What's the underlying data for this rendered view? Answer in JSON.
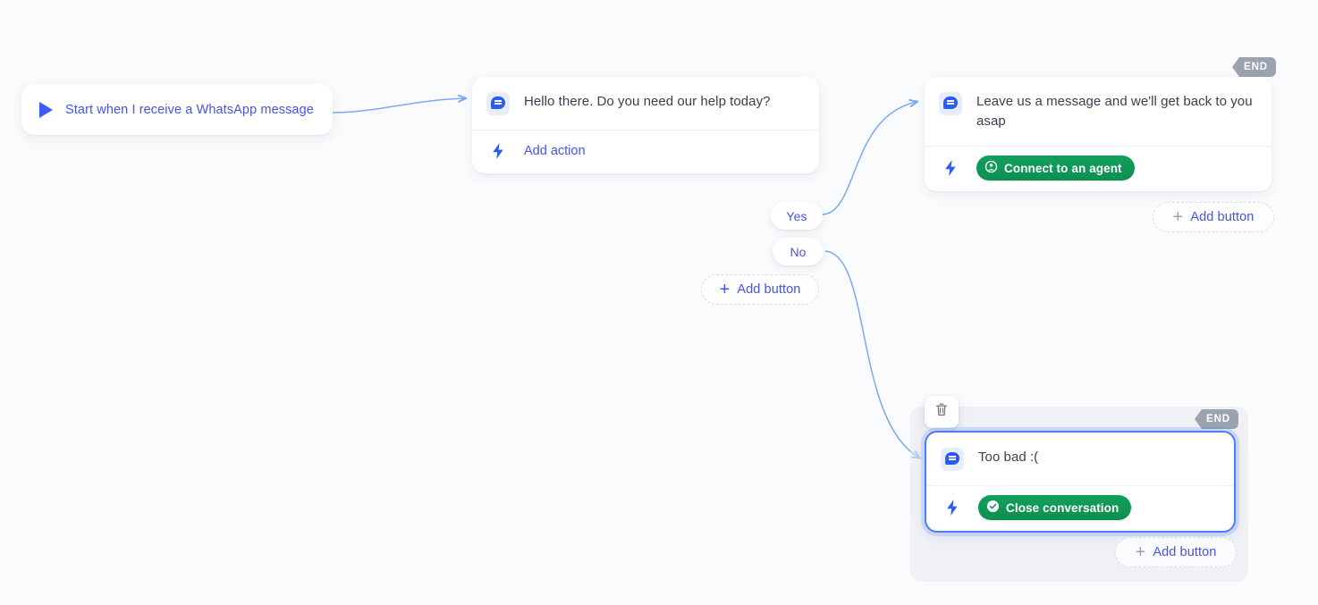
{
  "canvas": {
    "background_color": "#fafbfd",
    "grid_dot_color": "#e3e6ee",
    "accent_blue": "#4254ea",
    "edge_color": "#7aaaf5",
    "green": "#0f9d58",
    "end_badge_color": "#9ba3b0"
  },
  "trigger": {
    "icon": "play-icon",
    "label": "Start when I receive a WhatsApp message"
  },
  "nodes": [
    {
      "id": "greeting",
      "message_icon": "message-bubble-icon",
      "message": "Hello there. Do you need our help today?",
      "action_icon": "lightning-bolt-icon",
      "action_label": "Add action",
      "end_badge": null
    },
    {
      "id": "leave-message",
      "message_icon": "message-bubble-icon",
      "message": "Leave us a message and we'll get back to you asap",
      "action_icon": "lightning-bolt-icon",
      "action_button_label": "Connect to an agent",
      "action_button_icon": "agent-handoff-icon",
      "end_badge": "END"
    },
    {
      "id": "too-bad",
      "message_icon": "message-bubble-icon",
      "message": "Too bad :(",
      "action_icon": "lightning-bolt-icon",
      "action_button_label": "Close conversation",
      "action_button_icon": "check-circle-icon",
      "end_badge": "END",
      "selected": true
    }
  ],
  "buttons": {
    "yes": "Yes",
    "no": "No"
  },
  "add_buttons": {
    "under_choices": "Add button",
    "right_of_leave_message": "Add button",
    "under_too_bad": "Add button",
    "plus_icon": "plus-icon"
  },
  "toolbar": {
    "delete_icon": "trash-icon"
  }
}
